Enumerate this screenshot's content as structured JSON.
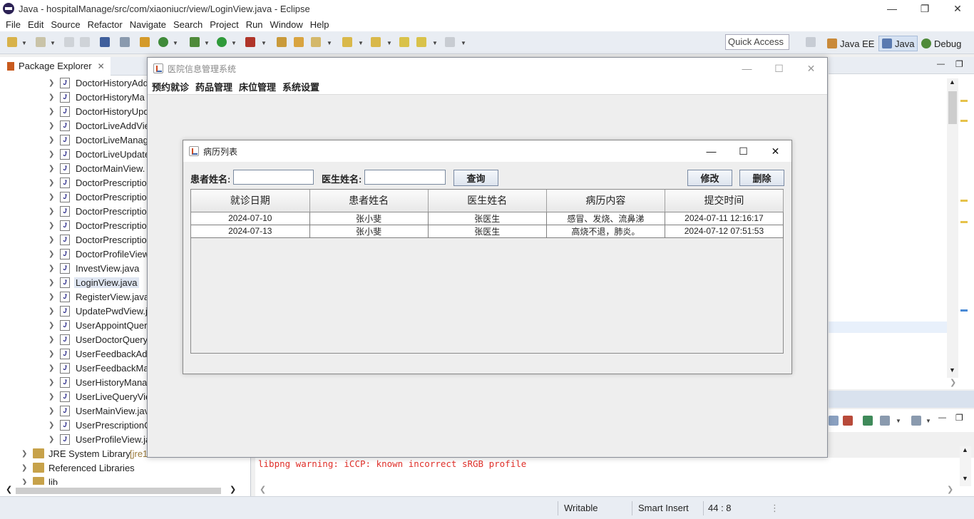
{
  "eclipse": {
    "title": "Java - hospitalManage/src/com/xiaoniucr/view/LoginView.java - Eclipse",
    "menu": [
      "File",
      "Edit",
      "Source",
      "Refactor",
      "Navigate",
      "Search",
      "Project",
      "Run",
      "Window",
      "Help"
    ],
    "quick_access": "Quick Access",
    "perspectives": [
      "Java EE",
      "Java",
      "Debug"
    ],
    "package_explorer_tab": "Package Explorer",
    "tree_items": [
      "DoctorHistoryAdd",
      "DoctorHistoryMa",
      "DoctorHistoryUpd",
      "DoctorLiveAddVie",
      "DoctorLiveManag",
      "DoctorLiveUpdate",
      "DoctorMainView.",
      "DoctorPrescriptio",
      "DoctorPrescriptio",
      "DoctorPrescriptio",
      "DoctorPrescriptio",
      "DoctorPrescriptio",
      "DoctorProfileView",
      "InvestView.java",
      "LoginView.java",
      "RegisterView.java",
      "UpdatePwdView.j",
      "UserAppointQuer",
      "UserDoctorQuery",
      "UserFeedbackAdd",
      "UserFeedbackMa",
      "UserHistoryMana",
      "UserLiveQueryVie",
      "UserMainView.jav",
      "UserPrescriptionC",
      "UserProfileView.ja"
    ],
    "selected_item": "LoginView.java",
    "libraries": [
      "JRE System Library",
      "Referenced Libraries",
      "lib"
    ],
    "jre_suffix": "[jre1",
    "console_text": "libpng warning: iCCP: known incorrect sRGB profile",
    "status": {
      "mode": "Writable",
      "insert": "Smart Insert",
      "position": "44 : 8"
    }
  },
  "app": {
    "title": "医院信息管理系统",
    "menu": [
      "预约就诊",
      "药品管理",
      "床位管理",
      "系统设置"
    ]
  },
  "frame": {
    "title": "病历列表",
    "patient_label": "患者姓名:",
    "patient_value": "",
    "doctor_label": "医生姓名:",
    "doctor_value": "",
    "query_button": "查询",
    "edit_button": "修改",
    "delete_button": "删除",
    "columns": [
      "就诊日期",
      "患者姓名",
      "医生姓名",
      "病历内容",
      "提交时间"
    ],
    "rows": [
      [
        "2024-07-10",
        "张小斐",
        "张医生",
        "感冒、发烧、流鼻涕",
        "2024-07-11 12:16:17"
      ],
      [
        "2024-07-13",
        "张小斐",
        "张医生",
        "高烧不退，肺炎。",
        "2024-07-12 07:51:53"
      ]
    ]
  },
  "colors": {
    "toolbar_bg": "#e9edf3",
    "console_warning": "#e0302a",
    "selection": "#dfe6f2"
  }
}
